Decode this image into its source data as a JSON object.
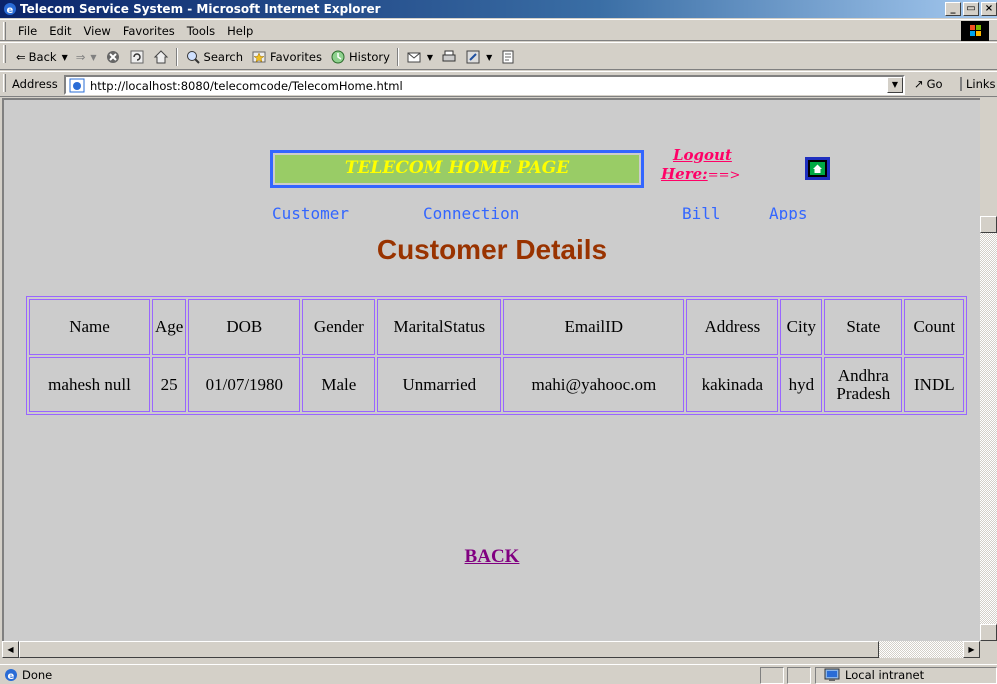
{
  "window": {
    "title": "Telecom Service System - Microsoft Internet Explorer",
    "buttons": [
      "_",
      "×"
    ]
  },
  "menubar": {
    "items": [
      "File",
      "Edit",
      "View",
      "Favorites",
      "Tools",
      "Help"
    ]
  },
  "toolbar": {
    "back": "Back",
    "search": "Search",
    "favorites": "Favorites",
    "history": "History"
  },
  "address": {
    "label": "Address",
    "url": "http://localhost:8080/telecomcode/TelecomHome.html",
    "go": "Go",
    "links": "Links"
  },
  "page": {
    "banner": "TELECOM HOME PAGE",
    "logout_line1": "Logout",
    "logout_here": "Here:",
    "logout_arrow": "==>",
    "nav": [
      "Customer",
      "Connection",
      "Bill",
      "Apps"
    ],
    "heading": "Customer Details",
    "table": {
      "headers": [
        "Name",
        "Age",
        "DOB",
        "Gender",
        "MaritalStatus",
        "EmailID",
        "Address",
        "City",
        "State",
        "Count"
      ],
      "row": [
        "mahesh null",
        "25",
        "01/07/1980",
        "Male",
        "Unmarried",
        "mahi@yahooc.om",
        "kakinada",
        "hyd",
        "Andhra Pradesh",
        "INDL"
      ]
    },
    "back": "BACK"
  },
  "status": {
    "text": "Done",
    "zone": "Local intranet"
  },
  "colors": {
    "banner_bg": "#99cc66",
    "banner_text": "#ffff00",
    "banner_border": "#3366ff",
    "logout": "#ff0066",
    "nav": "#3366ff",
    "heading": "#993300",
    "table_border": "#9966ff",
    "back": "#800080"
  }
}
